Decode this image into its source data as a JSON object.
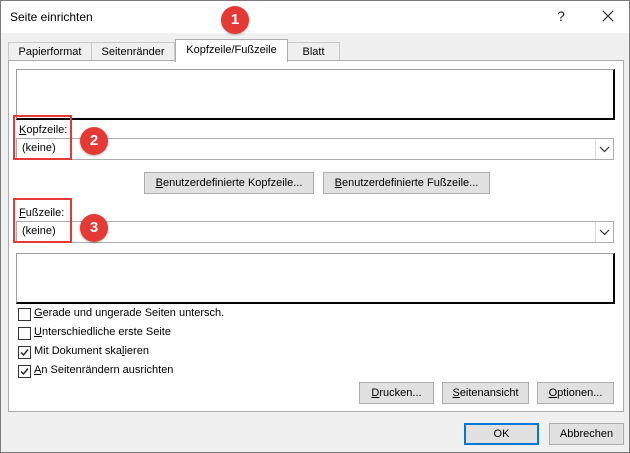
{
  "window": {
    "title": "Seite einrichten",
    "help_glyph": "?",
    "close_glyph": "✕"
  },
  "tabs": [
    {
      "label": "Papierformat",
      "active": false
    },
    {
      "label": "Seitenränder",
      "active": false
    },
    {
      "label": "Kopfzeile/Fußzeile",
      "active": true
    },
    {
      "label": "Blatt",
      "active": false
    }
  ],
  "header": {
    "label": "Kopfzeile:",
    "value": "(keine)"
  },
  "footer": {
    "label": "Fußzeile:",
    "value": "(keine)"
  },
  "custom_buttons": {
    "header": "Benutzerdefinierte Kopfzeile...",
    "footer": "Benutzerdefinierte Fußzeile..."
  },
  "options": [
    {
      "label": "Gerade und ungerade Seiten untersch.",
      "checked": false
    },
    {
      "label": "Unterschiedliche erste Seite",
      "checked": false
    },
    {
      "label": "Mit Dokument skalieren",
      "checked": true
    },
    {
      "label": "An Seitenrändern ausrichten",
      "checked": true
    }
  ],
  "panel_buttons": {
    "print": "Drucken...",
    "preview": "Seitenansicht",
    "options": "Optionen..."
  },
  "footer_buttons": {
    "ok": "OK",
    "cancel": "Abbrechen"
  },
  "annotations": [
    "1",
    "2",
    "3"
  ],
  "colors": {
    "annotation": "#e53935",
    "default_button_border": "#0078d7"
  }
}
